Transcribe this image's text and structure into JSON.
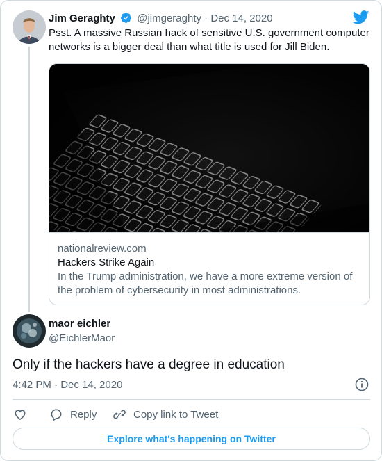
{
  "tweet": {
    "author_name": "Jim Geraghty",
    "author_handle": "@jimgeraghty",
    "separator": "·",
    "date": "Dec 14, 2020",
    "text": "Psst. A massive Russian hack of sensitive U.S. government computer networks is a bigger deal than what title is used for Jill Biden.",
    "link_card": {
      "domain": "nationalreview.com",
      "title": "Hackers Strike Again",
      "description": "In the Trump administration, we have a more extreme version of the problem of cybersecurity in most administrations."
    }
  },
  "reply": {
    "author_name": "maor eichler",
    "author_handle": "@EichlerMaor",
    "text": "Only if the hackers have a degree in education",
    "timestamp": "4:42 PM · Dec 14, 2020"
  },
  "actions": {
    "reply_label": "Reply",
    "copy_label": "Copy link to Tweet"
  },
  "explore_label": "Explore what's happening on Twitter",
  "icons": {
    "verified": "verified-badge-icon",
    "twitter": "twitter-bird-icon",
    "info": "info-icon",
    "like": "heart-icon",
    "reply": "reply-bubble-icon",
    "copy": "link-icon"
  },
  "colors": {
    "accent": "#1d9bf0",
    "muted_text": "#536471",
    "border": "#cfd9de",
    "text": "#0f1419"
  }
}
